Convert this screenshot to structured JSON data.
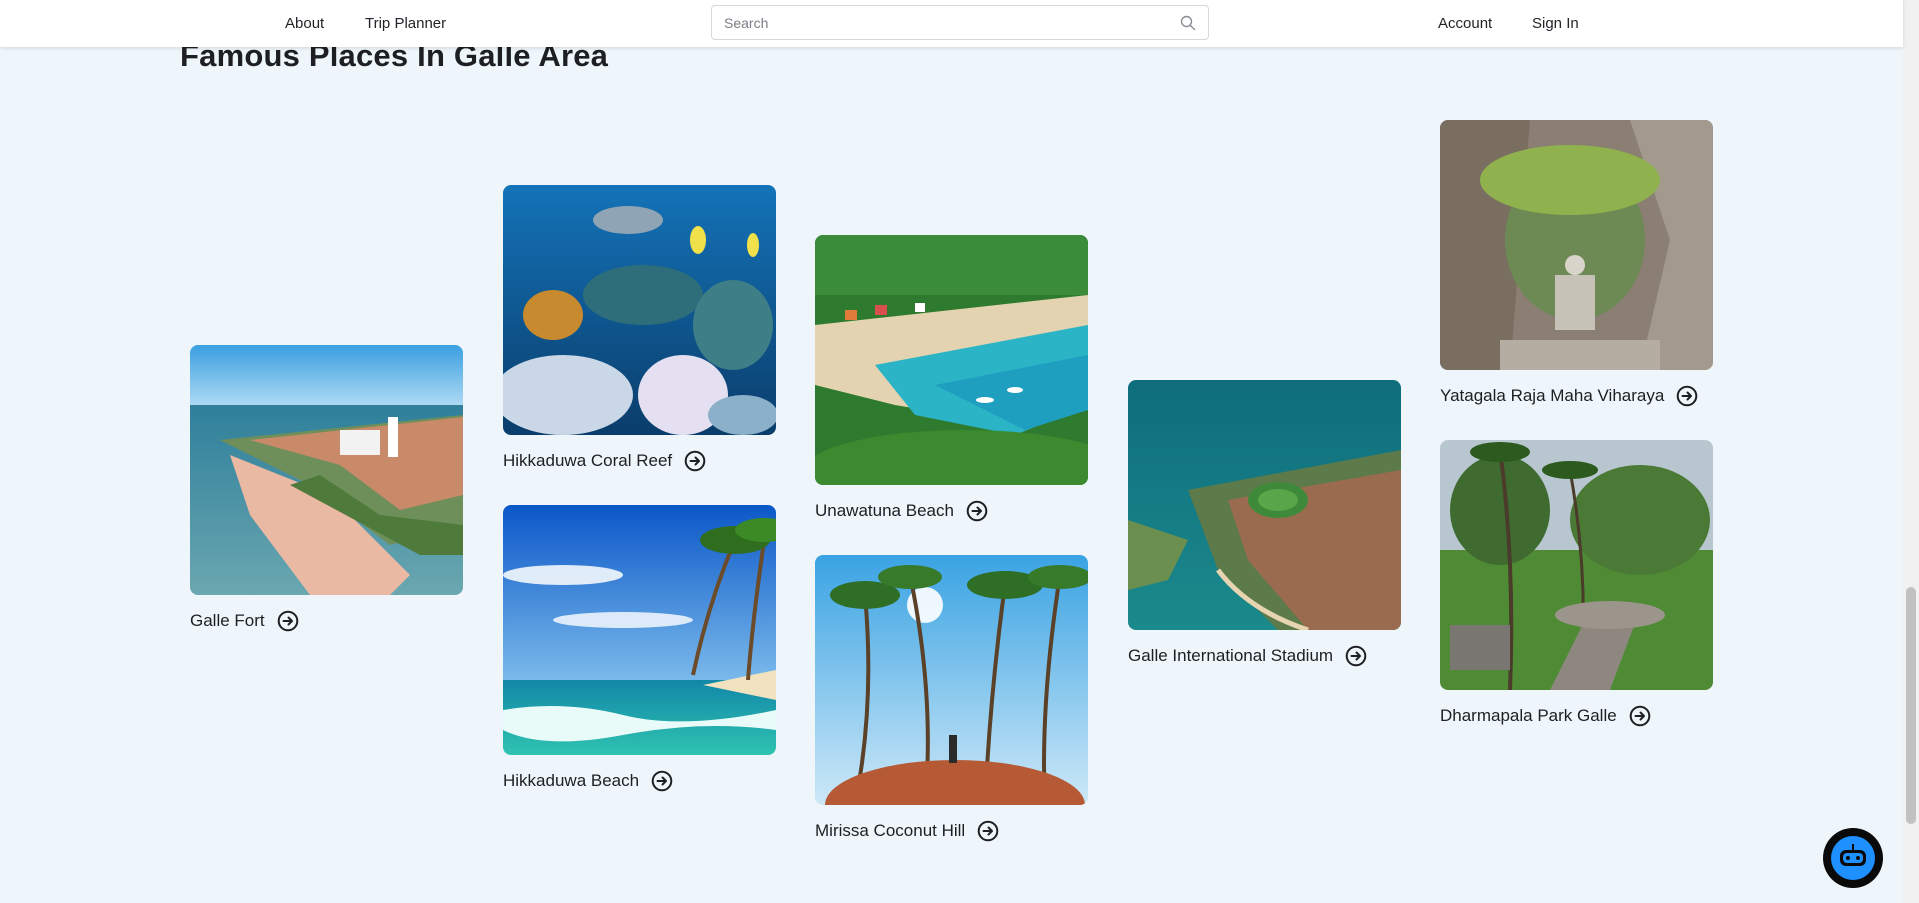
{
  "nav": {
    "about": "About",
    "trip_planner": "Trip Planner",
    "search_placeholder": "Search",
    "account": "Account",
    "sign_in": "Sign In"
  },
  "page": {
    "title": "Famous Places In Galle Area"
  },
  "places": [
    {
      "name": "Galle Fort",
      "image": "coastal fort with lighthouse"
    },
    {
      "name": "Hikkaduwa Coral Reef",
      "image": "coral reef with fish"
    },
    {
      "name": "Hikkaduwa Beach",
      "image": "palm trees over turquoise waves"
    },
    {
      "name": "Unawatuna Beach",
      "image": "aerial view of bay and beach"
    },
    {
      "name": "Mirissa Coconut Hill",
      "image": "palm grove on red hill"
    },
    {
      "name": "Galle International Stadium",
      "image": "aerial view of stadium and peninsula"
    },
    {
      "name": "Yatagala Raja Maha Viharaya",
      "image": "buddha statue under rock"
    },
    {
      "name": "Dharmapala Park Galle",
      "image": "park with palm trees and path"
    }
  ],
  "icons": {
    "search": "search-icon",
    "arrow": "arrow-right-circle-icon",
    "chat": "chatbot-icon"
  },
  "colors": {
    "background": "#eef6fc",
    "chat_accent": "#1e90ff"
  }
}
